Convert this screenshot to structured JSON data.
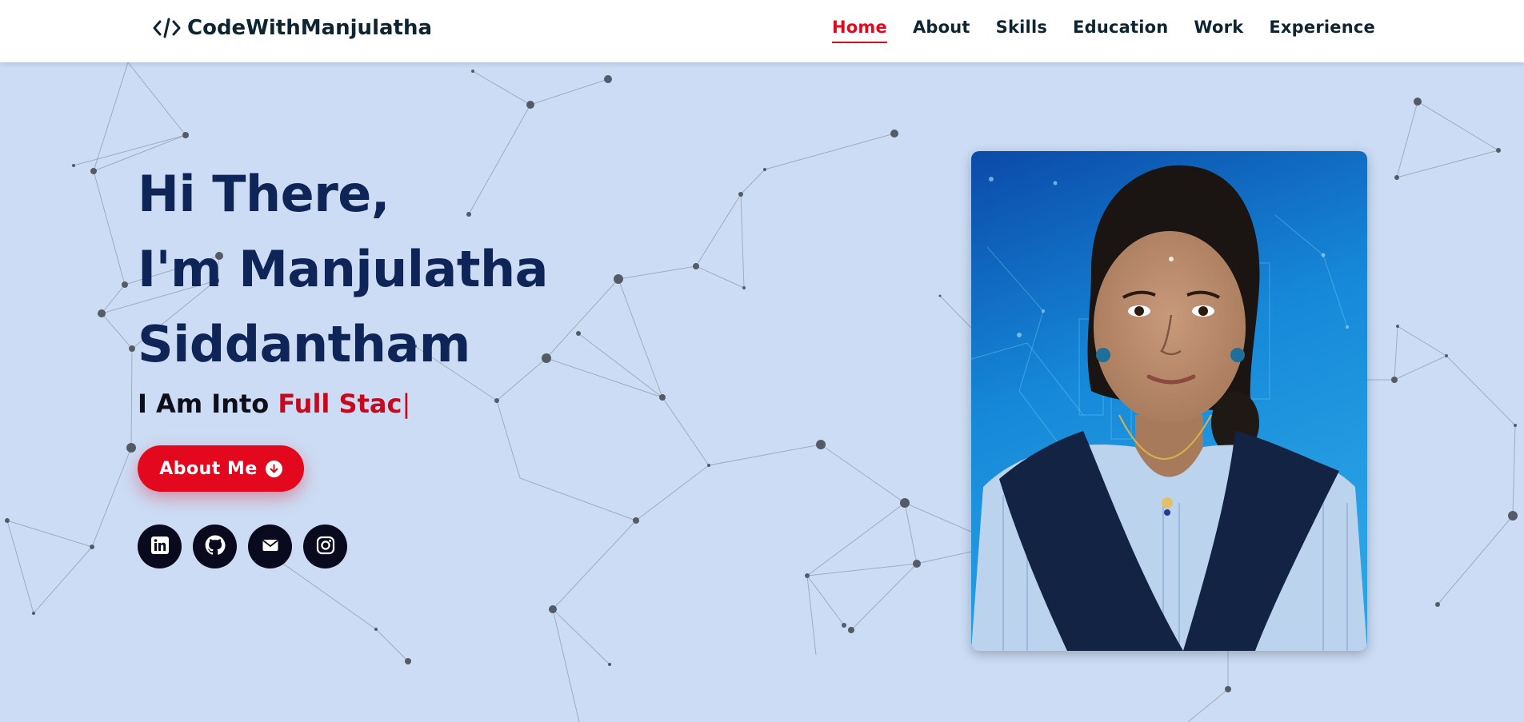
{
  "header": {
    "logo_text": "CodeWithManjulatha",
    "nav": [
      {
        "label": "Home",
        "active": true
      },
      {
        "label": "About",
        "active": false
      },
      {
        "label": "Skills",
        "active": false
      },
      {
        "label": "Education",
        "active": false
      },
      {
        "label": "Work",
        "active": false
      },
      {
        "label": "Experience",
        "active": false
      }
    ]
  },
  "hero": {
    "greeting": "Hi There,",
    "name_line1": "I'm Manjulatha",
    "name_line2": "Siddantham",
    "subtitle_prefix": "I Am Into ",
    "subtitle_typed": "Full Stac",
    "cursor": "|",
    "button_label": "About Me"
  },
  "socials": [
    {
      "icon": "linkedin-icon"
    },
    {
      "icon": "github-icon"
    },
    {
      "icon": "email-icon"
    },
    {
      "icon": "instagram-icon"
    }
  ],
  "colors": {
    "accent": "#e3081e",
    "heading": "#0f2557",
    "background": "#cbdcf4",
    "header_bg": "#ffffff"
  }
}
